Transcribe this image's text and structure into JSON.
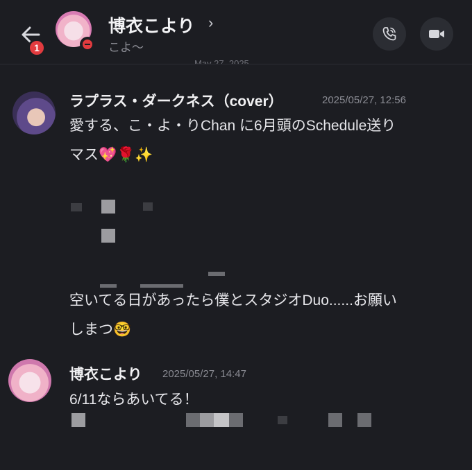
{
  "header": {
    "back_badge": "1",
    "title": "博衣こより",
    "chevron": "›",
    "subtitle": "こよ〜",
    "date_peek": "May 27, 2025"
  },
  "messages": [
    {
      "author": "ラプラス・ダークネス（cover）",
      "timestamp": "2025/05/27, 12:56",
      "line1": "愛する、こ・よ・りChan に6月頭のSchedule送り",
      "line2": "マス💖🌹✨",
      "line3": "空いてる日があったら僕とスタジオDuo......お願い",
      "line4": "しまつ🤓"
    },
    {
      "author": "博衣こより",
      "timestamp": "2025/05/27, 14:47",
      "line1": "6/11ならあいてる！"
    }
  ],
  "icons": {
    "back": "arrow-left-icon",
    "status": "do-not-disturb-icon",
    "call": "phone-call-icon",
    "video": "video-camera-icon"
  },
  "colors": {
    "background": "#1c1d22",
    "badge": "#e23b3f",
    "button_bg": "#2b2d33",
    "timestamp": "#8a8b93"
  }
}
